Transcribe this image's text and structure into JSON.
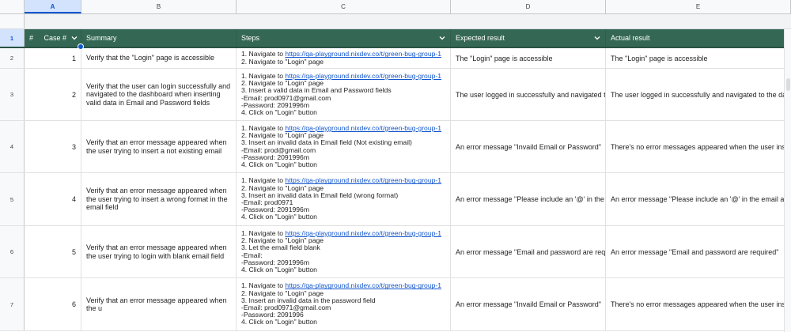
{
  "columns": [
    "A",
    "B",
    "C",
    "D",
    "E"
  ],
  "header": {
    "row_number": "1",
    "hash": "#",
    "case": "Case #",
    "summary": "Summary",
    "steps": "Steps",
    "expected": "Expected result",
    "actual": "Actual result"
  },
  "rows": [
    {
      "row": "2",
      "case": "1",
      "summary": "Verify that the \"Login\" page is accessible",
      "steps": [
        {
          "pre": "1. Navigate to ",
          "link": "https://qa-playground.nixdev.co/t/green-bug-group-1"
        },
        {
          "pre": "2. Navigate to \"Login\" page"
        }
      ],
      "expected": "The \"Login\" page is accessible",
      "actual": "The \"Login\" page is accessible"
    },
    {
      "row": "3",
      "case": "2",
      "summary": "Verify that the user can login successfully and navigated to the dashboard when inserting valid data in Email and Password fields",
      "steps": [
        {
          "pre": "1. Navigate to ",
          "link": "https://qa-playground.nixdev.co/t/green-bug-group-1"
        },
        {
          "pre": "2. Navigate to \"Login\" page"
        },
        {
          "pre": "3. Insert a valid data in Email and Password fields"
        },
        {
          "pre": "-Email: prod0971@gmail.com"
        },
        {
          "pre": "-Password: 2091996m"
        },
        {
          "pre": "4. Click on \"Login\" button"
        }
      ],
      "expected": "The user logged in successfully and navigated to the",
      "actual": "The user logged in successfully and navigated to the dash"
    },
    {
      "row": "4",
      "case": "3",
      "summary": "Verify that an error message appeared when the user trying to insert a not existing email",
      "steps": [
        {
          "pre": "1. Navigate to ",
          "link": "https://qa-playground.nixdev.co/t/green-bug-group-1"
        },
        {
          "pre": "2. Navigate to \"Login\" page"
        },
        {
          "pre": "3. Insert an invalid data in Email field (Not existing email)"
        },
        {
          "pre": "-Email: prod@gmail.com"
        },
        {
          "pre": "-Password: 2091996m"
        },
        {
          "pre": "4. Click on \"Login\" button"
        }
      ],
      "expected": "An error message \"Invaild Email or Password\"",
      "actual": "There's no error messages appeared when the user inserti"
    },
    {
      "row": "5",
      "case": "4",
      "summary": "Verify that an error message appeared when the user trying to insert a wrong format in the email field",
      "steps": [
        {
          "pre": "1. Navigate to ",
          "link": "https://qa-playground.nixdev.co/t/green-bug-group-1"
        },
        {
          "pre": "2. Navigate to \"Login\" page"
        },
        {
          "pre": "3. Insert an invalid data in Email field (wrong format)"
        },
        {
          "pre": "-Email: prod0971"
        },
        {
          "pre": "-Password: 2091996m"
        },
        {
          "pre": "4. Click on \"Login\" button"
        }
      ],
      "expected": "An error message \"Please include an '@' in the err",
      "actual": "An error message \"Please include an '@' in the email addr"
    },
    {
      "row": "6",
      "case": "5",
      "summary": "Verify that an error message appeared when the user trying to login with blank email field",
      "steps": [
        {
          "pre": "1. Navigate to ",
          "link": "https://qa-playground.nixdev.co/t/green-bug-group-1"
        },
        {
          "pre": "2. Navigate to \"Login\" page"
        },
        {
          "pre": "3. Let the email field blank"
        },
        {
          "pre": "-Email:"
        },
        {
          "pre": "-Password: 2091996m"
        },
        {
          "pre": "4. Click on \"Login\" button"
        }
      ],
      "expected": "An error message \"Email and password are requir",
      "actual": "An error message \"Email and password are required\""
    },
    {
      "row": "7",
      "case": "6",
      "summary": "Verify that an error message appeared when the u",
      "steps": [
        {
          "pre": "1. Navigate to ",
          "link": "https://qa-playground.nixdev.co/t/green-bug-group-1"
        },
        {
          "pre": "2. Navigate to \"Login\" page"
        },
        {
          "pre": "3. Insert an invalid data in the password field"
        },
        {
          "pre": "-Email: prod0971@gmail.com"
        },
        {
          "pre": "-Password: 2091996"
        },
        {
          "pre": "4. Click on \"Login\" button"
        }
      ],
      "expected": "An error message \"Invaild Email or Password\"",
      "actual": "There's no error messages appeared when the user inserti"
    }
  ],
  "colors": {
    "header_bg": "#356854",
    "selection": "#0b57d0",
    "link": "#1155cc"
  }
}
